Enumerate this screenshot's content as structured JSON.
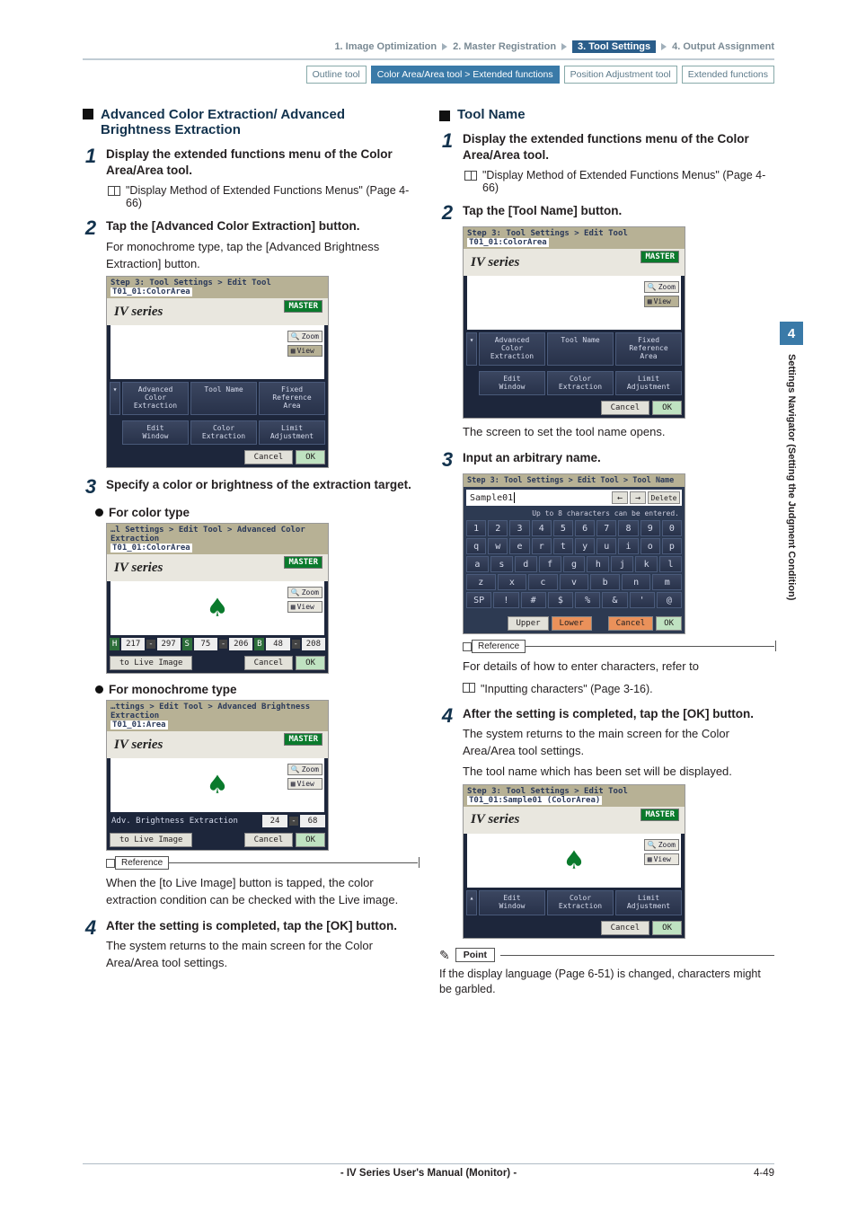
{
  "steps": {
    "s1": "1. Image Optimization",
    "s2": "2. Master Registration",
    "s3": "3. Tool Settings",
    "s4": "4. Output Assignment"
  },
  "tabs": {
    "outline": "Outline tool",
    "colorarea": "Color Area/Area tool > Extended functions",
    "position": "Position Adjustment tool",
    "extended": "Extended functions"
  },
  "sidebar": {
    "chapter": "4",
    "title": "Settings Navigator (Setting the Judgment Condition)"
  },
  "left": {
    "heading": "Advanced Color Extraction/ Advanced Brightness Extraction",
    "step1": {
      "title": "Display the extended functions menu of the Color Area/Area tool.",
      "link": "\"Display Method of Extended Functions Menus\" (Page 4-66)"
    },
    "step2": {
      "title": "Tap the [Advanced Color Extraction] button.",
      "desc": "For monochrome type, tap the [Advanced Brightness Extraction] button."
    },
    "scrA": {
      "crumb": "Step 3: Tool Settings > Edit Tool",
      "toolbadge": "T01_01:ColorArea",
      "product": "IV series",
      "master": "MASTER",
      "zoom": "Zoom",
      "view": "View",
      "btns": {
        "advcolor": "Advanced\nColor\nExtraction",
        "toolname": "Tool Name",
        "fixedref": "Fixed\nReference\nArea",
        "editwin": "Edit\nWindow",
        "colorext": "Color\nExtraction",
        "limitadj": "Limit\nAdjustment"
      },
      "cancel": "Cancel",
      "ok": "OK"
    },
    "step3": {
      "title": "Specify a color or brightness of the extraction target."
    },
    "for_color": "For color type",
    "scrB": {
      "crumb": "…l Settings > Edit Tool > Advanced Color Extraction",
      "toolbadge": "T01_01:ColorArea",
      "product": "IV series",
      "master": "MASTER",
      "zoom": "Zoom",
      "view": "View",
      "H": "H",
      "h1": "217",
      "h2": "297",
      "S": "S",
      "s1": "75",
      "s2": "206",
      "B": "B",
      "b1": "48",
      "b2": "208",
      "live": "to Live Image",
      "cancel": "Cancel",
      "ok": "OK"
    },
    "for_mono": "For monochrome type",
    "scrC": {
      "crumb": "…ttings > Edit Tool > Advanced Brightness Extraction",
      "toolbadge": "T01_01:Area",
      "product": "IV series",
      "master": "MASTER",
      "zoom": "Zoom",
      "view": "View",
      "ext_label": "Adv. Brightness Extraction",
      "v1": "24",
      "v2": "68",
      "live": "to Live Image",
      "cancel": "Cancel",
      "ok": "OK"
    },
    "reference": "Reference",
    "ref_body": "When the [to Live Image] button is tapped, the color extraction condition can be checked with the Live image.",
    "step4": {
      "title": "After the setting is completed, tap the [OK] button.",
      "desc": "The system returns to the main screen for the Color Area/Area tool settings."
    }
  },
  "right": {
    "heading": "Tool Name",
    "step1": {
      "title": "Display the extended functions menu of the Color Area/Area tool.",
      "link": "\"Display Method of Extended Functions Menus\" (Page 4-66)"
    },
    "step2": {
      "title": "Tap the [Tool Name] button."
    },
    "scrA": {
      "crumb": "Step 3: Tool Settings > Edit Tool",
      "toolbadge": "T01_01:ColorArea",
      "product": "IV series",
      "master": "MASTER",
      "zoom": "Zoom",
      "view": "View",
      "btns": {
        "advcolor": "Advanced\nColor\nExtraction",
        "toolname": "Tool Name",
        "fixedref": "Fixed\nReference\nArea",
        "editwin": "Edit\nWindow",
        "colorext": "Color\nExtraction",
        "limitadj": "Limit\nAdjustment"
      },
      "cancel": "Cancel",
      "ok": "OK"
    },
    "screen_opens": "The screen to set the tool name opens.",
    "step3": {
      "title": "Input an arbitrary name."
    },
    "kbd": {
      "top": "Step 3: Tool Settings > Edit Tool > Tool Name",
      "field": "Sample01",
      "left_arrow": "←",
      "right_arrow": "→",
      "delete": "Delete",
      "hint": "Up to 8 characters can be entered.",
      "r1": [
        "1",
        "2",
        "3",
        "4",
        "5",
        "6",
        "7",
        "8",
        "9",
        "0"
      ],
      "r2": [
        "q",
        "w",
        "e",
        "r",
        "t",
        "y",
        "u",
        "i",
        "o",
        "p"
      ],
      "r3": [
        "a",
        "s",
        "d",
        "f",
        "g",
        "h",
        "j",
        "k",
        "l"
      ],
      "r4": [
        "z",
        "x",
        "c",
        "v",
        "b",
        "n",
        "m"
      ],
      "r5": [
        "SP",
        "!",
        "#",
        "$",
        "%",
        "&",
        "'",
        "@"
      ],
      "upper": "Upper",
      "lower": "Lower",
      "cancel": "Cancel",
      "ok": "OK"
    },
    "reference": "Reference",
    "ref_body_a": "For details of how to enter characters, refer to",
    "ref_body_b": "\"Inputting characters\" (Page 3-16).",
    "step4": {
      "title": "After the setting is completed, tap the [OK] button.",
      "desc1": "The system returns to the main screen for the Color Area/Area tool settings.",
      "desc2": "The tool name which has been set will be displayed."
    },
    "scrD": {
      "crumb": "Step 3: Tool Settings > Edit Tool",
      "toolbadge": "T01_01:Sample01 (ColorArea)",
      "product": "IV series",
      "master": "MASTER",
      "zoom": "Zoom",
      "view": "View",
      "btns": {
        "editwin": "Edit\nWindow",
        "colorext": "Color\nExtraction",
        "limitadj": "Limit\nAdjustment"
      },
      "cancel": "Cancel",
      "ok": "OK"
    },
    "point": "Point",
    "point_body": "If the display language (Page 6-51) is changed, characters might be garbled."
  },
  "footer": {
    "center": "- IV Series User's Manual (Monitor) -",
    "page": "4-49"
  }
}
